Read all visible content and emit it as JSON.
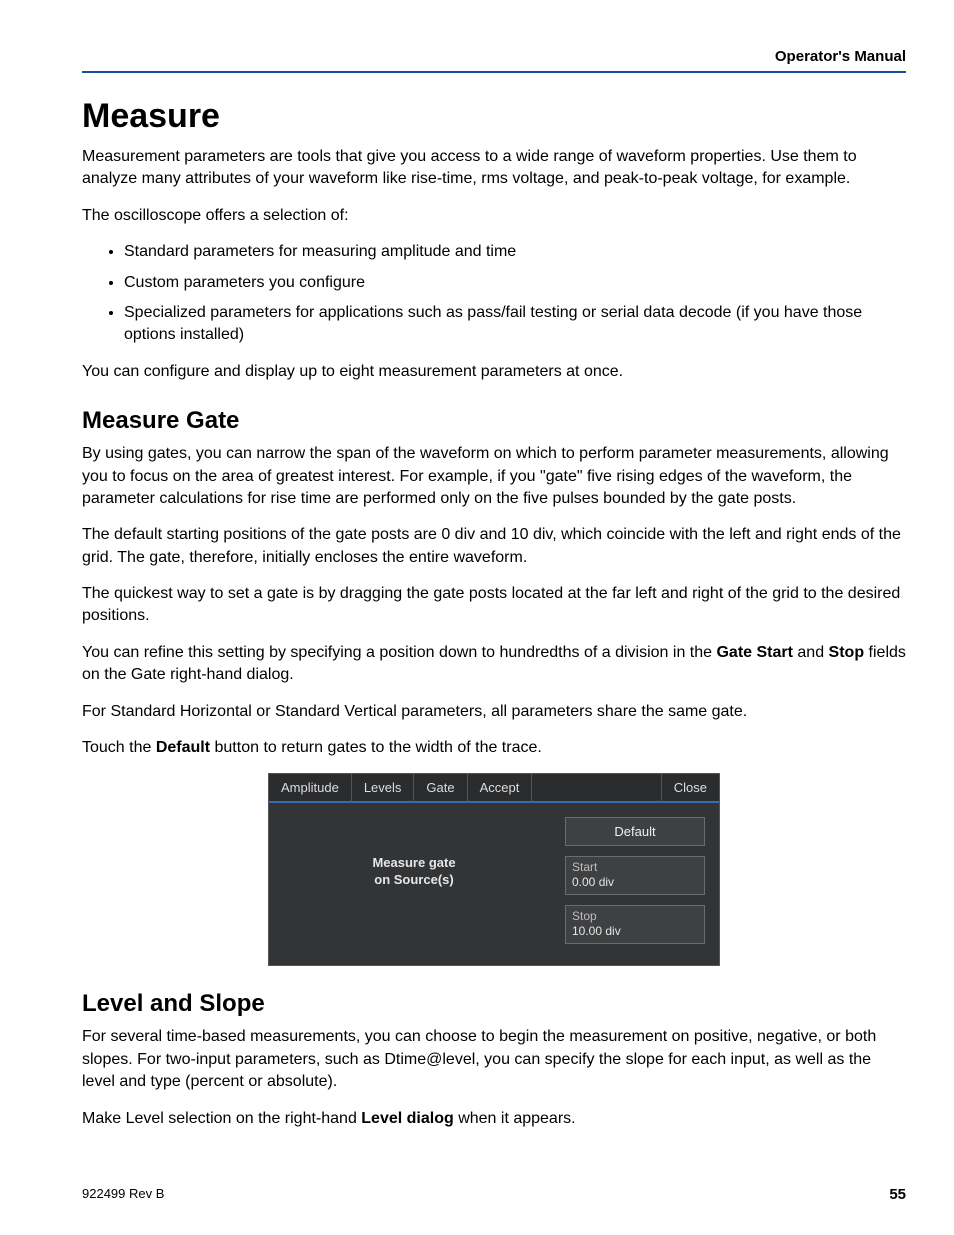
{
  "header": {
    "right": "Operator's Manual"
  },
  "h1": "Measure",
  "intro_p1": "Measurement parameters are tools that give you access to a wide range of waveform properties. Use them to analyze many attributes of your waveform like rise-time, rms voltage, and peak-to-peak voltage, for example.",
  "intro_p2": "The oscilloscope offers a selection of:",
  "bullets": [
    "Standard parameters for measuring amplitude and time",
    "Custom parameters you configure",
    "Specialized parameters for applications such as pass/fail testing or serial data decode (if you have those options installed)"
  ],
  "intro_p3": "You can configure and display up to eight measurement parameters at once.",
  "h2a": "Measure Gate",
  "gate_p1": "By using gates, you can narrow the span of the waveform on which to perform parameter measurements, allowing you to focus on the area of greatest interest. For example, if you \"gate\" five rising edges of the waveform, the parameter calculations for rise time are performed only on the five pulses bounded by the gate posts.",
  "gate_p2": "The default starting positions of the gate posts are 0 div and 10 div, which coincide with the left and right ends of the grid. The gate, therefore, initially encloses the entire waveform.",
  "gate_p3": "The quickest way to set a gate is by dragging the gate posts located at the far left and right of the grid to the desired positions.",
  "gate_p4_a": "You can refine this setting by specifying a position down to hundredths of a division in the ",
  "gate_p4_b1": "Gate Start",
  "gate_p4_c": " and ",
  "gate_p4_b2": "Stop",
  "gate_p4_d": " fields on the Gate right-hand dialog.",
  "gate_p5": "For Standard Horizontal or Standard Vertical parameters, all parameters share the same gate.",
  "gate_p6_a": "Touch the ",
  "gate_p6_b": "Default",
  "gate_p6_c": " button to return gates to the width of the trace.",
  "dialog": {
    "tabs": {
      "amplitude": "Amplitude",
      "levels": "Levels",
      "gate": "Gate",
      "accept": "Accept",
      "close": "Close"
    },
    "left_label_l1": "Measure gate",
    "left_label_l2": "on Source(s)",
    "default_btn": "Default",
    "start_label": "Start",
    "start_value": "0.00 div",
    "stop_label": "Stop",
    "stop_value": "10.00 div"
  },
  "h2b": "Level and Slope",
  "ls_p1": "For several time-based measurements, you can choose to begin the measurement on positive, negative, or both slopes. For two-input parameters, such as Dtime@level, you can specify the slope for each input, as well as the level and type (percent or absolute).",
  "ls_p2_a": "Make Level selection on the right-hand ",
  "ls_p2_b": "Level dialog",
  "ls_p2_c": " when it appears.",
  "footer": {
    "rev": "922499 Rev B",
    "page": "55"
  }
}
